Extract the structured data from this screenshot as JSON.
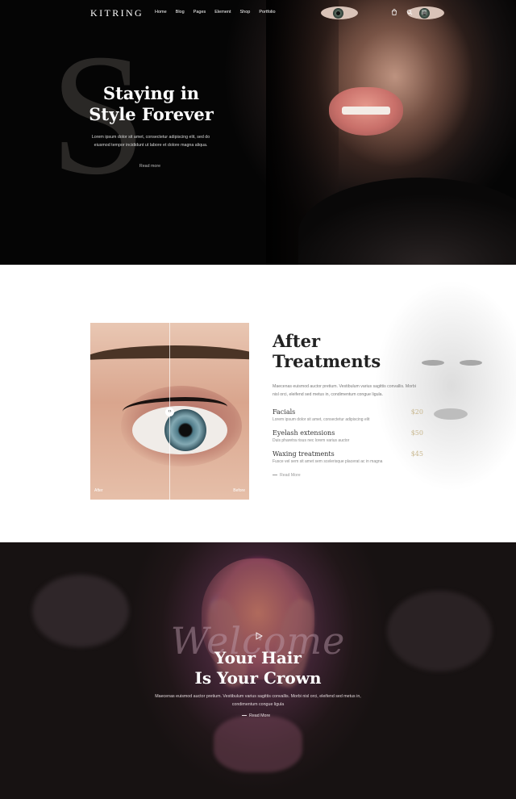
{
  "header": {
    "logo": "KITRING",
    "menu": [
      "Home",
      "Blog",
      "Pages",
      "Element",
      "Shop",
      "Portfolio"
    ],
    "icons": [
      "cart-icon",
      "search-icon",
      "menu-icon"
    ]
  },
  "hero": {
    "watermark": "S",
    "title_line1": "Staying in",
    "title_line2": "Style Forever",
    "text": "Lorem ipsum dolor sit amet, consectetur adipiscing elit, sed do eiusmod tempor incididunt ut labore et dolore magna aliqua.",
    "link": "Read more"
  },
  "treatments": {
    "title_line1": "After",
    "title_line2": "Treatments",
    "description": "Maecenas euismod auctor pretium. Vestibulum varius sagittis convallis. Morbi nisl orci, eleifend sed metus in, condimentum congue ligula.",
    "photo_labels": {
      "left": "After",
      "right": "Before"
    },
    "services": [
      {
        "name": "Facials",
        "desc": "Lorem ipsum dolor sit amet, consectetur adipiscing elit",
        "price": "$20"
      },
      {
        "name": "Eyelash extensions",
        "desc": "Duis pharetra risus nec lorem varius auctor",
        "price": "$50"
      },
      {
        "name": "Waxing treatments",
        "desc": "Fusce vel sem sit amet sem scelerisque placerat ac in magna",
        "price": "$45"
      }
    ],
    "link": "Read More"
  },
  "welcome": {
    "script": "Welcome",
    "title_line1": "Your Hair",
    "title_line2": "Is Your Crown",
    "text": "Maecenas euismod auctor pretium. Vestibulum varius sagittis convallis. Morbi nisl orci, eleifend sed metus in, condimentum congue ligula",
    "link": "Read More"
  }
}
